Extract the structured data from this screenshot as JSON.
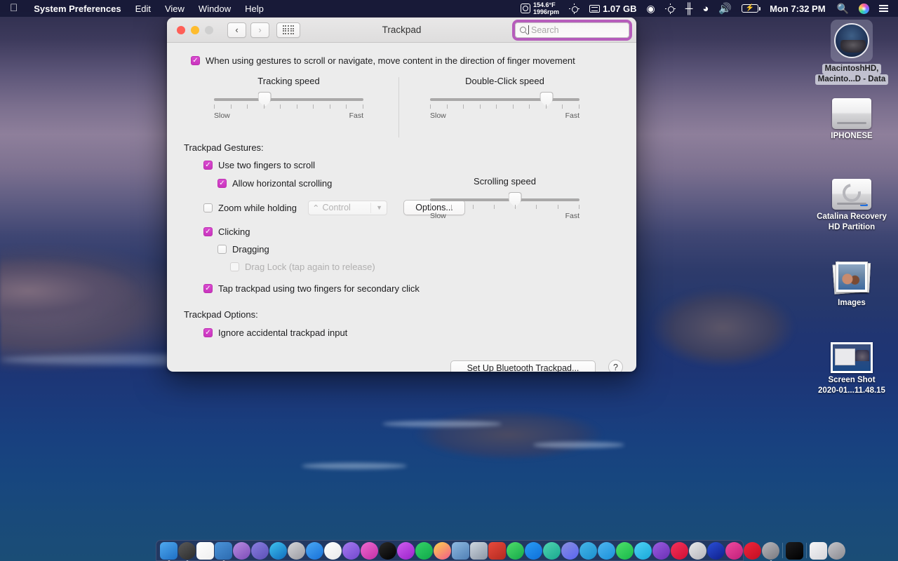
{
  "menubar": {
    "apple_icon": "apple-logo",
    "app_name": "System Preferences",
    "menus": [
      "Edit",
      "View",
      "Window",
      "Help"
    ],
    "status": {
      "temperature": "154.6°F",
      "fan_speed": "1996rpm",
      "brightness_icon": "sun-icon",
      "ram_icon": "memory-icon",
      "ram_used": "1.07 GB",
      "eye_icon": "eye-monitor-icon",
      "display_icon": "brightness-icon",
      "bluetooth_icon": "bluetooth-icon",
      "wifi_icon": "wifi-icon",
      "volume_icon": "volume-icon",
      "battery_icon": "battery-charging-icon",
      "clock": "Mon 7:32 PM",
      "spotlight_icon": "search-icon",
      "siri_icon": "siri-icon",
      "control_center_icon": "control-center-icon"
    }
  },
  "desktop": {
    "icons": [
      {
        "name": "MacintoshHD,\nMacinto...D - Data",
        "line1": "MacintoshHD,",
        "line2": "Macinto...D - Data",
        "kind": "catalina-disk",
        "selected": true
      },
      {
        "name": "IPHONESE",
        "line1": "IPHONESE",
        "line2": "",
        "kind": "external-drive",
        "selected": false
      },
      {
        "name": "Catalina Recovery HD Partition",
        "line1": "Catalina Recovery",
        "line2": "HD Partition",
        "kind": "recovery-drive",
        "selected": false
      },
      {
        "name": "Images",
        "line1": "Images",
        "line2": "",
        "kind": "photo-stack",
        "selected": false
      },
      {
        "name": "Screen Shot 2020-01...11.48.15",
        "line1": "Screen Shot",
        "line2": "2020-01...11.48.15",
        "kind": "screenshot-file",
        "selected": false
      }
    ]
  },
  "window": {
    "title": "Trackpad",
    "traffic_lights": [
      "close",
      "minimize",
      "zoom"
    ],
    "nav": {
      "back": "‹",
      "forward": "›",
      "grid": "show-all-grid"
    },
    "search": {
      "placeholder": "Search",
      "value": "",
      "focused": true,
      "focus_ring_color": "#b355b8"
    }
  },
  "main": {
    "natural_scroll": {
      "label": "When using gestures to scroll or navigate, move content in the direction of finger movement",
      "checked": true
    },
    "sliders": [
      {
        "id": "tracking-speed",
        "title": "Tracking speed",
        "min_label": "Slow",
        "max_label": "Fast",
        "value_pct": 34,
        "ticks": 10
      },
      {
        "id": "double-click-speed",
        "title": "Double-Click speed",
        "min_label": "Slow",
        "max_label": "Fast",
        "value_pct": 78,
        "ticks": 10
      },
      {
        "id": "scrolling-speed",
        "title": "Scrolling speed",
        "min_label": "Slow",
        "max_label": "Fast",
        "value_pct": 57,
        "ticks": 8
      }
    ],
    "gestures_heading": "Trackpad Gestures:",
    "gestures": [
      {
        "id": "two-fingers-scroll",
        "label": "Use two fingers to scroll",
        "checked": true,
        "enabled": true,
        "indent": 1
      },
      {
        "id": "horizontal-scrolling",
        "label": "Allow horizontal scrolling",
        "checked": true,
        "enabled": true,
        "indent": 2
      },
      {
        "id": "zoom-while-holding",
        "label": "Zoom while holding",
        "checked": false,
        "enabled": true,
        "indent": 1
      },
      {
        "id": "clicking",
        "label": "Clicking",
        "checked": true,
        "enabled": true,
        "indent": 1
      },
      {
        "id": "dragging",
        "label": "Dragging",
        "checked": false,
        "enabled": true,
        "indent": 2
      },
      {
        "id": "drag-lock",
        "label": "Drag Lock (tap again to release)",
        "checked": false,
        "enabled": false,
        "indent": 3
      },
      {
        "id": "secondary-click",
        "label": "Tap trackpad using two fingers for secondary click",
        "checked": true,
        "enabled": true,
        "indent": 1
      }
    ],
    "modifier_popup": {
      "value": "Control",
      "symbol": "⌃",
      "enabled": false
    },
    "options_button": "Options...",
    "options_heading": "Trackpad Options:",
    "options": [
      {
        "id": "ignore-accidental-input",
        "label": "Ignore accidental trackpad input",
        "checked": true,
        "enabled": true
      }
    ],
    "setup_button": "Set Up Bluetooth Trackpad...",
    "help_button": "?"
  },
  "dock": {
    "items": [
      {
        "name": "finder",
        "color1": "#4fa9ef",
        "color2": "#1e6fc4",
        "running": true
      },
      {
        "name": "dashboard",
        "color1": "#5a5a5a",
        "color2": "#2b2b2b",
        "running": true
      },
      {
        "name": "calendar",
        "color1": "#ffffff",
        "color2": "#efefef",
        "running": false
      },
      {
        "name": "weather",
        "color1": "#4b93d8",
        "color2": "#2c6bb0",
        "running": true
      },
      {
        "name": "safari",
        "color1": "#b98de0",
        "color2": "#7b4bb8",
        "running": false
      },
      {
        "name": "launchpad-rocket",
        "color1": "#8a7fe0",
        "color2": "#5a4fb5",
        "running": false
      },
      {
        "name": "edge",
        "color1": "#3fc3f0",
        "color2": "#0f6cbd",
        "running": false
      },
      {
        "name": "rocket",
        "color1": "#d5d5d9",
        "color2": "#9a9aa0",
        "running": false
      },
      {
        "name": "app-store",
        "color1": "#4aa8f5",
        "color2": "#1670d8",
        "running": false
      },
      {
        "name": "music-white",
        "color1": "#ffffff",
        "color2": "#e8e8ea",
        "running": false
      },
      {
        "name": "music-purple",
        "color1": "#a77af0",
        "color2": "#7148cf",
        "running": false
      },
      {
        "name": "itunes",
        "color1": "#f06ad0",
        "color2": "#c02ea6",
        "running": false
      },
      {
        "name": "apple-tv",
        "color1": "#2a2a2a",
        "color2": "#000000",
        "running": false
      },
      {
        "name": "podcasts",
        "color1": "#cf5df0",
        "color2": "#9a22c9",
        "running": false
      },
      {
        "name": "spotify",
        "color1": "#35d267",
        "color2": "#0fa84a",
        "running": false
      },
      {
        "name": "photos",
        "color1": "#ffd34d",
        "color2": "#f05a8a",
        "running": false
      },
      {
        "name": "preview",
        "color1": "#8fb9e0",
        "color2": "#4f7fb5",
        "running": false
      },
      {
        "name": "image-capture",
        "color1": "#cfd7e0",
        "color2": "#8a95a5",
        "running": false
      },
      {
        "name": "keynote-red",
        "color1": "#e84a3c",
        "color2": "#b32a20",
        "running": false
      },
      {
        "name": "whatsapp",
        "color1": "#4fdd6a",
        "color2": "#15a94a",
        "running": false
      },
      {
        "name": "messenger",
        "color1": "#2a9cf5",
        "color2": "#0d6fd8",
        "running": false
      },
      {
        "name": "instagram",
        "color1": "#51d4b0",
        "color2": "#18a88f",
        "running": false
      },
      {
        "name": "discord",
        "color1": "#8b8fe0",
        "color2": "#5865f2",
        "running": false
      },
      {
        "name": "telegram",
        "color1": "#46b6e8",
        "color2": "#1a8fcf",
        "running": false
      },
      {
        "name": "twitter",
        "color1": "#4fb5f0",
        "color2": "#1a91da",
        "running": false
      },
      {
        "name": "facetime",
        "color1": "#4ee06a",
        "color2": "#18b84a",
        "running": false
      },
      {
        "name": "messages",
        "color1": "#4fd1f5",
        "color2": "#18a8d8",
        "running": false
      },
      {
        "name": "skype-purple",
        "color1": "#9b5ce0",
        "color2": "#6a2fb5",
        "running": false
      },
      {
        "name": "youtube",
        "color1": "#f5325b",
        "color2": "#cf0f33",
        "running": false
      },
      {
        "name": "play-store",
        "color1": "#e8e8ea",
        "color2": "#b5b5ba",
        "running": false
      },
      {
        "name": "media-player",
        "color1": "#2a4fd8",
        "color2": "#0f1f8a",
        "running": false
      },
      {
        "name": "pink-app",
        "color1": "#f04a9e",
        "color2": "#c01f7a",
        "running": false
      },
      {
        "name": "record-red",
        "color1": "#f0253b",
        "color2": "#c00f22",
        "running": false
      },
      {
        "name": "system-preferences",
        "color1": "#b8b8bd",
        "color2": "#78787e",
        "running": true
      },
      {
        "name": "separator",
        "color1": "",
        "color2": "",
        "running": false
      },
      {
        "name": "terminal",
        "color1": "#1d1d1f",
        "color2": "#000000",
        "running": false
      },
      {
        "name": "separator",
        "color1": "",
        "color2": "",
        "running": false
      },
      {
        "name": "document",
        "color1": "#f5f5f7",
        "color2": "#d5d5da",
        "running": false
      },
      {
        "name": "trash",
        "color1": "#c5c5ca",
        "color2": "#8a8a90",
        "running": false
      }
    ]
  }
}
